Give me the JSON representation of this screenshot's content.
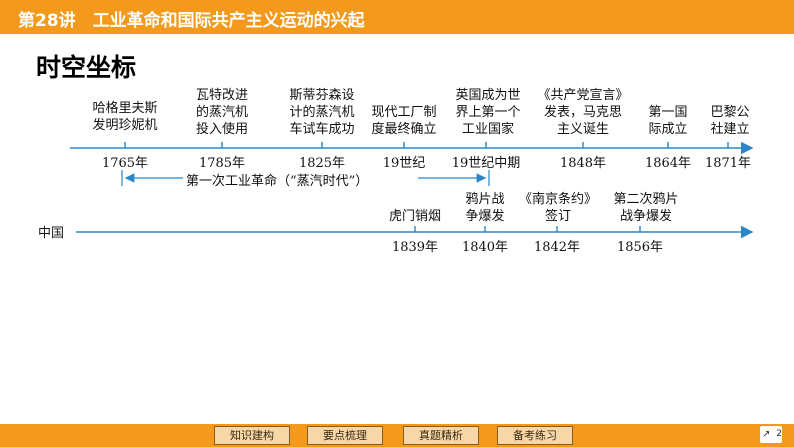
{
  "header": {
    "title": "第28讲　工业革命和国际共产主义运动的兴起"
  },
  "section_title": "时空坐标",
  "world_events": [
    {
      "lines": [
        "哈格里夫斯",
        "发明珍妮机"
      ],
      "year": "1765年"
    },
    {
      "lines": [
        "瓦特改进",
        "的蒸汽机",
        "投入使用"
      ],
      "year": "1785年"
    },
    {
      "lines": [
        "斯蒂芬森设",
        "计的蒸汽机",
        "车试车成功"
      ],
      "year": "1825年"
    },
    {
      "lines": [
        "现代工厂制",
        "度最终确立"
      ],
      "year": "19世纪"
    },
    {
      "lines": [
        "英国成为世",
        "界上第一个",
        "工业国家"
      ],
      "year": "19世纪中期"
    },
    {
      "lines": [
        "《共产党宣言》",
        "发表，马克思",
        "主义诞生"
      ],
      "year": "1848年"
    },
    {
      "lines": [
        "第一国",
        "际成立"
      ],
      "year": "1864年"
    },
    {
      "lines": [
        "巴黎公",
        "社建立"
      ],
      "year": "1871年"
    }
  ],
  "era_label": "第一次工业革命（“蒸汽时代”）",
  "china": {
    "label": "中国",
    "events": [
      {
        "lines": [
          "虎门销烟"
        ],
        "year": "1839年"
      },
      {
        "lines": [
          "鸦片战",
          "争爆发"
        ],
        "year": "1840年"
      },
      {
        "lines": [
          "《南京条约》",
          "签订"
        ],
        "year": "1842年"
      },
      {
        "lines": [
          "第二次鸦片",
          "战争爆发"
        ],
        "year": "1856年"
      }
    ]
  },
  "nav": {
    "buttons": [
      "知识建构",
      "要点梳理",
      "真题精析",
      "备考练习"
    ],
    "page": "2"
  },
  "colors": {
    "accent": "#f39a1c",
    "timeline": "#2a86c8",
    "button_bg": "#f7d6a7"
  }
}
